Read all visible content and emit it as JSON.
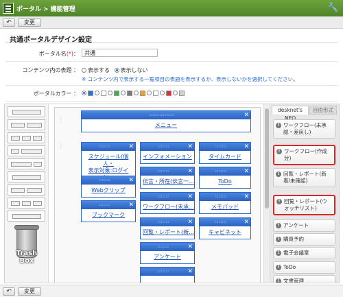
{
  "header": {
    "portal": "ポータル",
    "sep": ">",
    "page": "機能管理"
  },
  "toolbar": {
    "back_icon": "↶",
    "change_label": "変更"
  },
  "title": "共通ポータルデザイン設定",
  "form": {
    "name_label": "ポータル名",
    "name_required": "(*)",
    "name_colon": "：",
    "name_value": "共通",
    "content_title_label": "コンテンツ内の表題 ：",
    "opt_show": "表示する",
    "opt_hide": "表示しない",
    "note": "※ コンテンツ内で表示する一覧項目の表題を表示するか、表示しないかを選択してください。",
    "color_label": "ポータルカラー ：",
    "colors": [
      "#2f6fd6",
      "#ffffff",
      "#3bb34a",
      "#777777",
      "#f0a020",
      "#ffffff",
      "#e03030",
      "#cfcfcf"
    ]
  },
  "widgets": {
    "menu": "メニュー",
    "schedule": "スケジュール(個人・表示対象:ログイン...",
    "schedule_l1": "スケジュール(個人・",
    "schedule_l2": "表示対象:ログイン...",
    "information": "インフォメーション",
    "timecard": "タイムカード",
    "webclip": "Webクリップ",
    "dengon": "伝言・所在(伝言一...",
    "todo": "ToDo",
    "bookmark": "ブックマーク",
    "workflow": "ワークフロー(未承...",
    "memopad": "メモパッド",
    "kairan": "回覧・レポート(新...",
    "cabinet": "キャビネット",
    "questionnaire": "アンケート"
  },
  "trash_label": "Trash Box",
  "panel": {
    "tab_neo": "desknet's NEO",
    "tab_custom": "自由形式",
    "items": [
      "ワークフロー(未承認・差戻し)",
      "ワークフロー(作成分)",
      "回覧・レポート(新着/未確認)",
      "回覧・レポート(ウォッチリスト)",
      "アンケート",
      "購買予約",
      "電子会議室",
      "ToDo",
      "文書管理"
    ]
  }
}
